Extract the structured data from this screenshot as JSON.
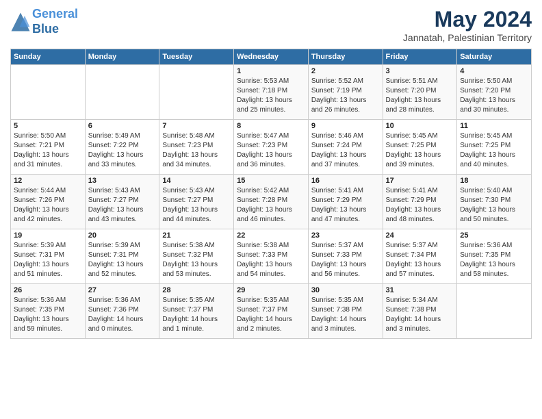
{
  "header": {
    "logo_line1": "General",
    "logo_line2": "Blue",
    "month_title": "May 2024",
    "location": "Jannatah, Palestinian Territory"
  },
  "weekdays": [
    "Sunday",
    "Monday",
    "Tuesday",
    "Wednesday",
    "Thursday",
    "Friday",
    "Saturday"
  ],
  "weeks": [
    [
      {
        "day": "",
        "info": ""
      },
      {
        "day": "",
        "info": ""
      },
      {
        "day": "",
        "info": ""
      },
      {
        "day": "1",
        "info": "Sunrise: 5:53 AM\nSunset: 7:18 PM\nDaylight: 13 hours\nand 25 minutes."
      },
      {
        "day": "2",
        "info": "Sunrise: 5:52 AM\nSunset: 7:19 PM\nDaylight: 13 hours\nand 26 minutes."
      },
      {
        "day": "3",
        "info": "Sunrise: 5:51 AM\nSunset: 7:20 PM\nDaylight: 13 hours\nand 28 minutes."
      },
      {
        "day": "4",
        "info": "Sunrise: 5:50 AM\nSunset: 7:20 PM\nDaylight: 13 hours\nand 30 minutes."
      }
    ],
    [
      {
        "day": "5",
        "info": "Sunrise: 5:50 AM\nSunset: 7:21 PM\nDaylight: 13 hours\nand 31 minutes."
      },
      {
        "day": "6",
        "info": "Sunrise: 5:49 AM\nSunset: 7:22 PM\nDaylight: 13 hours\nand 33 minutes."
      },
      {
        "day": "7",
        "info": "Sunrise: 5:48 AM\nSunset: 7:23 PM\nDaylight: 13 hours\nand 34 minutes."
      },
      {
        "day": "8",
        "info": "Sunrise: 5:47 AM\nSunset: 7:23 PM\nDaylight: 13 hours\nand 36 minutes."
      },
      {
        "day": "9",
        "info": "Sunrise: 5:46 AM\nSunset: 7:24 PM\nDaylight: 13 hours\nand 37 minutes."
      },
      {
        "day": "10",
        "info": "Sunrise: 5:45 AM\nSunset: 7:25 PM\nDaylight: 13 hours\nand 39 minutes."
      },
      {
        "day": "11",
        "info": "Sunrise: 5:45 AM\nSunset: 7:25 PM\nDaylight: 13 hours\nand 40 minutes."
      }
    ],
    [
      {
        "day": "12",
        "info": "Sunrise: 5:44 AM\nSunset: 7:26 PM\nDaylight: 13 hours\nand 42 minutes."
      },
      {
        "day": "13",
        "info": "Sunrise: 5:43 AM\nSunset: 7:27 PM\nDaylight: 13 hours\nand 43 minutes."
      },
      {
        "day": "14",
        "info": "Sunrise: 5:43 AM\nSunset: 7:27 PM\nDaylight: 13 hours\nand 44 minutes."
      },
      {
        "day": "15",
        "info": "Sunrise: 5:42 AM\nSunset: 7:28 PM\nDaylight: 13 hours\nand 46 minutes."
      },
      {
        "day": "16",
        "info": "Sunrise: 5:41 AM\nSunset: 7:29 PM\nDaylight: 13 hours\nand 47 minutes."
      },
      {
        "day": "17",
        "info": "Sunrise: 5:41 AM\nSunset: 7:29 PM\nDaylight: 13 hours\nand 48 minutes."
      },
      {
        "day": "18",
        "info": "Sunrise: 5:40 AM\nSunset: 7:30 PM\nDaylight: 13 hours\nand 50 minutes."
      }
    ],
    [
      {
        "day": "19",
        "info": "Sunrise: 5:39 AM\nSunset: 7:31 PM\nDaylight: 13 hours\nand 51 minutes."
      },
      {
        "day": "20",
        "info": "Sunrise: 5:39 AM\nSunset: 7:31 PM\nDaylight: 13 hours\nand 52 minutes."
      },
      {
        "day": "21",
        "info": "Sunrise: 5:38 AM\nSunset: 7:32 PM\nDaylight: 13 hours\nand 53 minutes."
      },
      {
        "day": "22",
        "info": "Sunrise: 5:38 AM\nSunset: 7:33 PM\nDaylight: 13 hours\nand 54 minutes."
      },
      {
        "day": "23",
        "info": "Sunrise: 5:37 AM\nSunset: 7:33 PM\nDaylight: 13 hours\nand 56 minutes."
      },
      {
        "day": "24",
        "info": "Sunrise: 5:37 AM\nSunset: 7:34 PM\nDaylight: 13 hours\nand 57 minutes."
      },
      {
        "day": "25",
        "info": "Sunrise: 5:36 AM\nSunset: 7:35 PM\nDaylight: 13 hours\nand 58 minutes."
      }
    ],
    [
      {
        "day": "26",
        "info": "Sunrise: 5:36 AM\nSunset: 7:35 PM\nDaylight: 13 hours\nand 59 minutes."
      },
      {
        "day": "27",
        "info": "Sunrise: 5:36 AM\nSunset: 7:36 PM\nDaylight: 14 hours\nand 0 minutes."
      },
      {
        "day": "28",
        "info": "Sunrise: 5:35 AM\nSunset: 7:37 PM\nDaylight: 14 hours\nand 1 minute."
      },
      {
        "day": "29",
        "info": "Sunrise: 5:35 AM\nSunset: 7:37 PM\nDaylight: 14 hours\nand 2 minutes."
      },
      {
        "day": "30",
        "info": "Sunrise: 5:35 AM\nSunset: 7:38 PM\nDaylight: 14 hours\nand 3 minutes."
      },
      {
        "day": "31",
        "info": "Sunrise: 5:34 AM\nSunset: 7:38 PM\nDaylight: 14 hours\nand 3 minutes."
      },
      {
        "day": "",
        "info": ""
      }
    ]
  ]
}
